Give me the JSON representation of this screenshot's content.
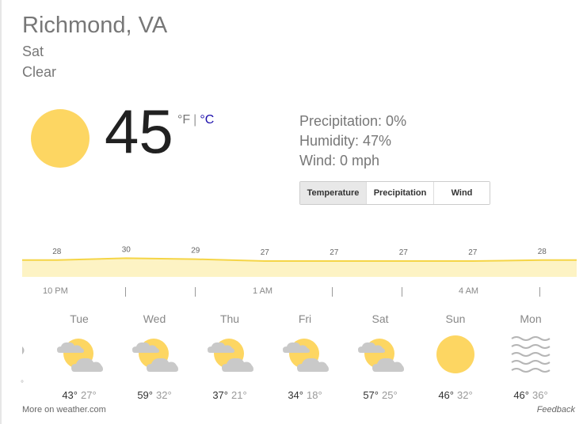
{
  "header": {
    "location": "Richmond, VA",
    "day": "Sat",
    "condition": "Clear"
  },
  "current": {
    "temp": "45",
    "unit_f": "°F",
    "unit_sep": "|",
    "unit_c": "°C",
    "icon": "sun-icon"
  },
  "stats": {
    "precipitation": "Precipitation: 0%",
    "humidity": "Humidity: 47%",
    "wind": "Wind: 0 mph"
  },
  "tabs": [
    {
      "label": "Temperature",
      "active": true
    },
    {
      "label": "Precipitation",
      "active": false
    },
    {
      "label": "Wind",
      "active": false
    }
  ],
  "chart_data": {
    "type": "area",
    "values": [
      28,
      30,
      29,
      27,
      27,
      27,
      27,
      28
    ],
    "value_labels": [
      "28",
      "30",
      "29",
      "27",
      "27",
      "27",
      "27",
      "28"
    ],
    "x_labels": [
      "10 PM",
      "1 AM",
      "4 AM"
    ],
    "ylim": [
      0,
      30
    ],
    "colors": {
      "line": "#f5d547",
      "fill": "#fdf3c4"
    }
  },
  "forecast": [
    {
      "day": "Tue",
      "hi": "43°",
      "lo": "27°",
      "icon": "partly-cloudy-icon"
    },
    {
      "day": "Wed",
      "hi": "59°",
      "lo": "32°",
      "icon": "partly-cloudy-icon"
    },
    {
      "day": "Thu",
      "hi": "37°",
      "lo": "21°",
      "icon": "partly-cloudy-icon"
    },
    {
      "day": "Fri",
      "hi": "34°",
      "lo": "18°",
      "icon": "partly-cloudy-icon"
    },
    {
      "day": "Sat",
      "hi": "57°",
      "lo": "25°",
      "icon": "partly-cloudy-icon"
    },
    {
      "day": "Sun",
      "hi": "46°",
      "lo": "32°",
      "icon": "sun-icon"
    },
    {
      "day": "Mon",
      "hi": "46°",
      "lo": "36°",
      "icon": "haze-icon"
    }
  ],
  "footer": {
    "more": "More on weather.com",
    "feedback": "Feedback"
  }
}
